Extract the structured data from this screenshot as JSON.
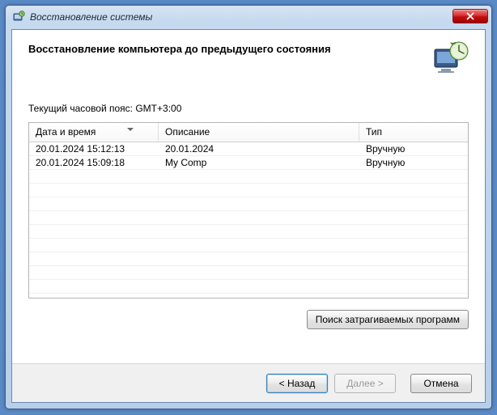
{
  "window": {
    "title": "Восстановление системы"
  },
  "header": {
    "title": "Восстановление компьютера до предыдущего состояния"
  },
  "timezone_label": "Текущий часовой пояс: GMT+3:00",
  "table": {
    "columns": {
      "date": "Дата и время",
      "desc": "Описание",
      "type": "Тип"
    },
    "rows": [
      {
        "date": "20.01.2024 15:12:13",
        "desc": "20.01.2024",
        "type": "Вручную"
      },
      {
        "date": "20.01.2024 15:09:18",
        "desc": "My Comp",
        "type": "Вручную"
      }
    ]
  },
  "buttons": {
    "affected": "Поиск затрагиваемых программ",
    "back": "< Назад",
    "next": "Далее >",
    "cancel": "Отмена"
  }
}
